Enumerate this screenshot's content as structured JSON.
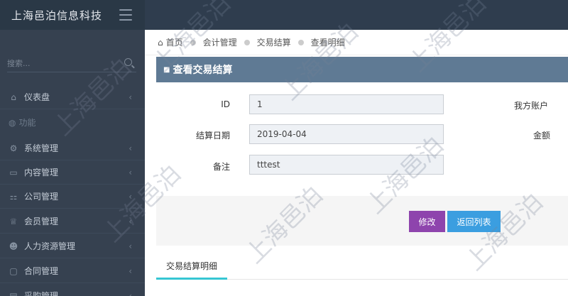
{
  "header": {
    "brand": "上海邑泊信息科技"
  },
  "sidebar": {
    "search_placeholder": "搜索...",
    "section_label": "功能",
    "items": [
      {
        "label": "仪表盘",
        "icon": "home-icon"
      },
      {
        "label": "系统管理",
        "icon": "cogs-icon"
      },
      {
        "label": "内容管理",
        "icon": "content-icon"
      },
      {
        "label": "公司管理",
        "icon": "sitemap-icon"
      },
      {
        "label": "会员管理",
        "icon": "trophy-icon"
      },
      {
        "label": "人力资源管理",
        "icon": "users-icon"
      },
      {
        "label": "合同管理",
        "icon": "document-icon"
      },
      {
        "label": "采购管理",
        "icon": "cart-icon"
      }
    ]
  },
  "breadcrumb": {
    "items": [
      "首页",
      "会计管理",
      "交易结算",
      "查看明细"
    ]
  },
  "page": {
    "title": "查看交易结算"
  },
  "form": {
    "id_label": "ID",
    "id_value": "1",
    "date_label": "结算日期",
    "date_value": "2019-04-04",
    "note_label": "备注",
    "note_value": "tttest",
    "account_label": "我方账户",
    "amount_label": "金额"
  },
  "actions": {
    "edit": "修改",
    "back": "返回列表"
  },
  "tabs": {
    "detail": "交易结算明细"
  },
  "watermark": "上海邑泊",
  "colors": {
    "accent_header": "#5f7a94",
    "edit_button": "#8e44ad",
    "back_button": "#3b9ee0",
    "tab_underline": "#36c6d3"
  }
}
